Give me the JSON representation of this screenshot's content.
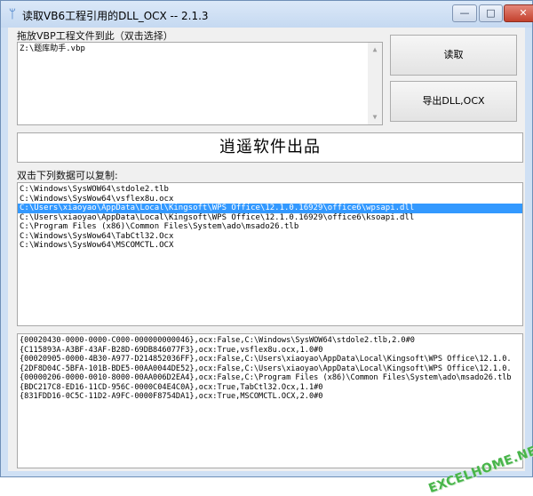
{
  "window": {
    "title": "读取VB6工程引用的DLL_OCX -- 2.1.3",
    "app_icon": "antenna-icon",
    "controls": {
      "minimize": "—",
      "maximize": "□",
      "close": "✕"
    }
  },
  "drop_area": {
    "label": "拖放VBP工程文件到此（双击选择）",
    "value": "Z:\\题库助手.vbp"
  },
  "buttons": {
    "read": "读取",
    "export": "导出DLL,OCX"
  },
  "banner": "逍遥软件出品",
  "list_section": {
    "label": "双击下列数据可以复制:",
    "items": [
      "C:\\Windows\\SysWOW64\\stdole2.tlb",
      "C:\\Windows\\SysWow64\\vsflex8u.ocx",
      "C:\\Users\\xiaoyao\\AppData\\Local\\Kingsoft\\WPS Office\\12.1.0.16929\\office6\\wpsapi.dll",
      "C:\\Users\\xiaoyao\\AppData\\Local\\Kingsoft\\WPS Office\\12.1.0.16929\\office6\\ksoapi.dll",
      "C:\\Program Files (x86)\\Common Files\\System\\ado\\msado26.tlb",
      "C:\\Windows\\SysWow64\\TabCtl32.Ocx",
      "C:\\Windows\\SysWow64\\MSCOMCTL.OCX"
    ],
    "selected_index": 2
  },
  "details": {
    "lines": [
      "{00020430-0000-0000-C000-000000000046},ocx:False,C:\\Windows\\SysWOW64\\stdole2.tlb,2.0#0",
      "{C115893A-A3BF-43AF-B28D-69DB846077F3},ocx:True,vsflex8u.ocx,1.0#0",
      "{00020905-0000-4B30-A977-D214852036FF},ocx:False,C:\\Users\\xiaoyao\\AppData\\Local\\Kingsoft\\WPS Office\\12.1.0.",
      "{2DF8D04C-5BFA-101B-BDE5-00AA0044DE52},ocx:False,C:\\Users\\xiaoyao\\AppData\\Local\\Kingsoft\\WPS Office\\12.1.0.",
      "{00000206-0000-0010-8000-00AA006D2EA4},ocx:False,C:\\Program Files (x86)\\Common Files\\System\\ado\\msado26.tlb",
      "{BDC217C8-ED16-11CD-956C-0000C04E4C0A},ocx:True,TabCtl32.Ocx,1.1#0",
      "{831FDD16-0C5C-11D2-A9FC-0000F8754DA1},ocx:True,MSCOMCTL.OCX,2.0#0"
    ]
  },
  "watermark": "EXCELHOME.NET",
  "colors": {
    "selection": "#3399ff",
    "close_button": "#c3412d",
    "watermark": "#48b54a"
  }
}
